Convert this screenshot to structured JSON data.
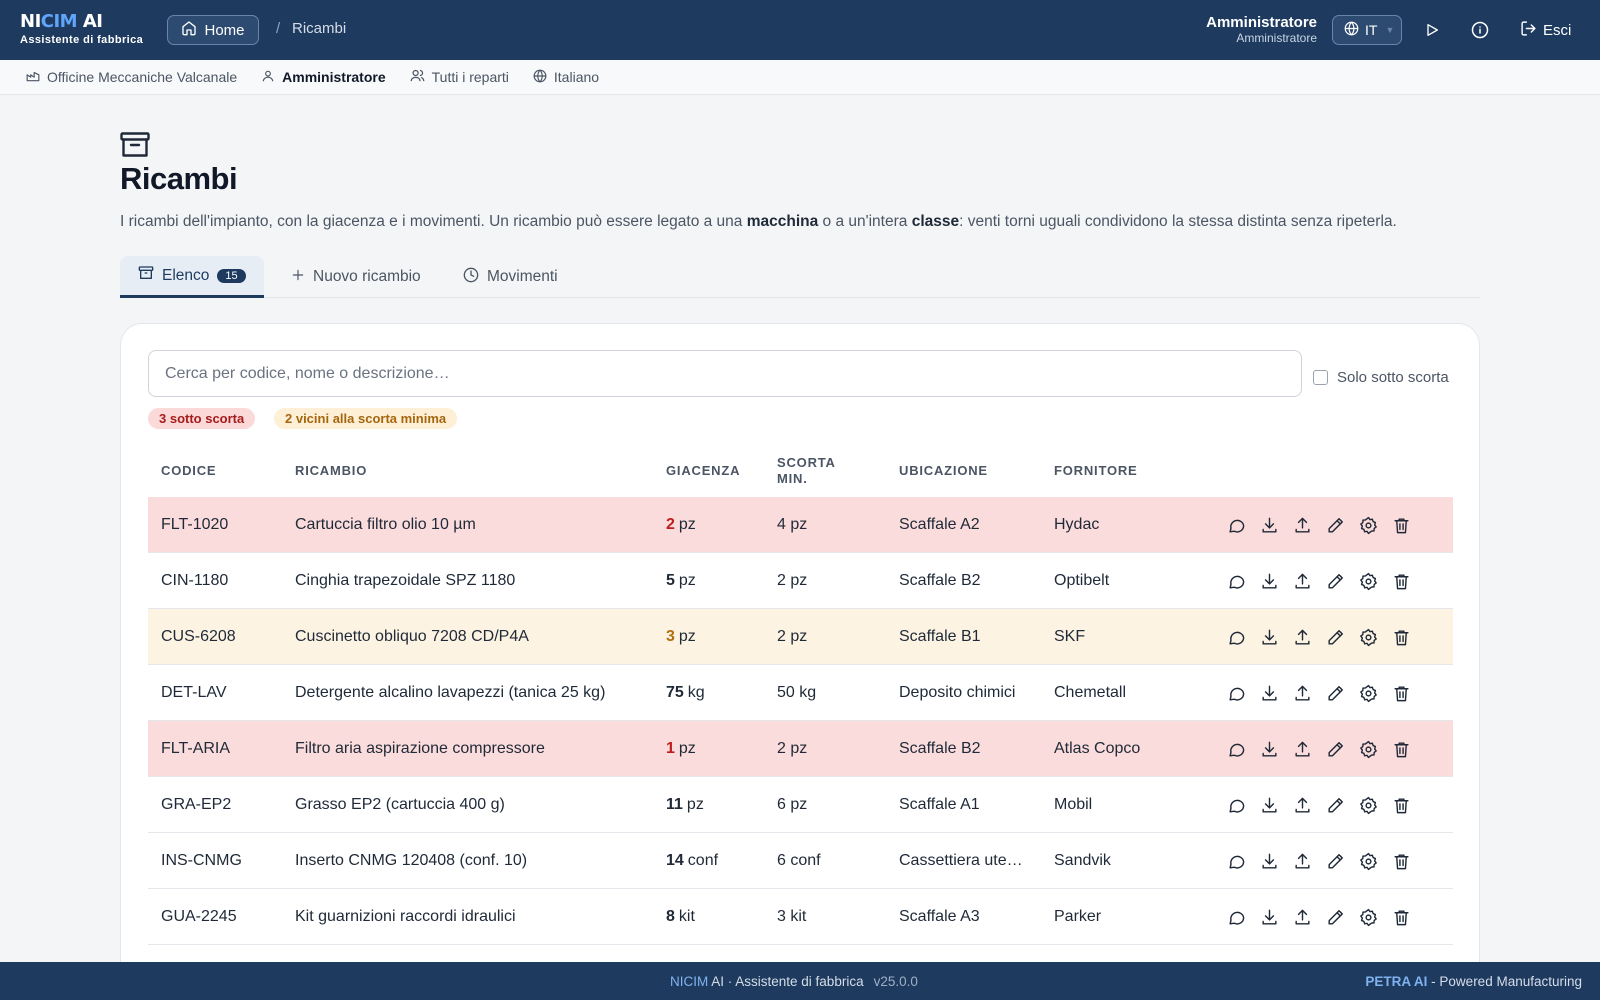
{
  "app": {
    "brand_a": "NI",
    "brand_b": "CIM",
    "brand_c": " AI",
    "subtitle": "Assistente di fabbrica"
  },
  "header": {
    "home_label": "Home",
    "breadcrumb_sep": "/",
    "breadcrumb_current": "Ricambi",
    "user_name": "Amministratore",
    "user_role": "Amministratore",
    "lang": "IT",
    "logout": "Esci"
  },
  "context": {
    "company": "Officine Meccaniche Valcanale",
    "user": "Amministratore",
    "departments": "Tutti i reparti",
    "language": "Italiano"
  },
  "page": {
    "title": "Ricambi",
    "desc_1": "I ricambi dell'impianto, con la giacenza e i movimenti. Un ricambio può essere legato a una ",
    "desc_b1": "macchina",
    "desc_2": " o a un'intera ",
    "desc_b2": "classe",
    "desc_3": ": venti torni uguali condividono la stessa distinta senza ripeterla."
  },
  "tabs": {
    "list": "Elenco",
    "list_count": "15",
    "new": "Nuovo ricambio",
    "moves": "Movimenti"
  },
  "filters": {
    "search_placeholder": "Cerca per codice, nome o descrizione…",
    "below_stock_label": "Solo sotto scorta",
    "pill_below": "3 sotto scorta",
    "pill_near": "2 vicini alla scorta minima"
  },
  "table": {
    "headers": {
      "code": "CODICE",
      "part": "RICAMBIO",
      "stock": "GIACENZA",
      "min_1": "SCORTA",
      "min_2": "MIN.",
      "location": "UBICAZIONE",
      "supplier": "FORNITORE"
    },
    "rows": [
      {
        "code": "FLT-1020",
        "name": "Cartuccia filtro olio 10 µm",
        "qty": "2",
        "unit": "pz",
        "min": "4 pz",
        "loc": "Scaffale A2",
        "supplier": "Hydac",
        "status": "low"
      },
      {
        "code": "CIN-1180",
        "name": "Cinghia trapezoidale SPZ 1180",
        "qty": "5",
        "unit": "pz",
        "min": "2 pz",
        "loc": "Scaffale B2",
        "supplier": "Optibelt",
        "status": "ok"
      },
      {
        "code": "CUS-6208",
        "name": "Cuscinetto obliquo 7208 CD/P4A",
        "qty": "3",
        "unit": "pz",
        "min": "2 pz",
        "loc": "Scaffale B1",
        "supplier": "SKF",
        "status": "warn"
      },
      {
        "code": "DET-LAV",
        "name": "Detergente alcalino lavapezzi (tanica 25 kg)",
        "qty": "75",
        "unit": "kg",
        "min": "50 kg",
        "loc": "Deposito chimici",
        "supplier": "Chemetall",
        "status": "ok"
      },
      {
        "code": "FLT-ARIA",
        "name": "Filtro aria aspirazione compressore",
        "qty": "1",
        "unit": "pz",
        "min": "2 pz",
        "loc": "Scaffale B2",
        "supplier": "Atlas Copco",
        "status": "low"
      },
      {
        "code": "GRA-EP2",
        "name": "Grasso EP2 (cartuccia 400 g)",
        "qty": "11",
        "unit": "pz",
        "min": "6 pz",
        "loc": "Scaffale A1",
        "supplier": "Mobil",
        "status": "ok"
      },
      {
        "code": "INS-CNMG",
        "name": "Inserto CNMG 120408 (conf. 10)",
        "qty": "14",
        "unit": "conf",
        "min": "6 conf",
        "loc": "Cassettiera ute…",
        "supplier": "Sandvik",
        "status": "ok"
      },
      {
        "code": "GUA-2245",
        "name": "Kit guarnizioni raccordi idraulici",
        "qty": "8",
        "unit": "kit",
        "min": "3 kit",
        "loc": "Scaffale A3",
        "supplier": "Parker",
        "status": "ok"
      }
    ]
  },
  "footer": {
    "brand_a": "NICIM",
    "brand_b": " AI · Assistente di fabbrica",
    "version": "v25.0.0",
    "powered_a": "PETRA AI",
    "powered_b": " - Powered Manufacturing"
  },
  "colors": {
    "primary": "#1e3a5f",
    "accent": "#60a5fa",
    "low_row": "#fbdcdc",
    "warn_row": "#fdf3e2",
    "low_text": "#c01c1c",
    "warn_text": "#b26f10"
  }
}
